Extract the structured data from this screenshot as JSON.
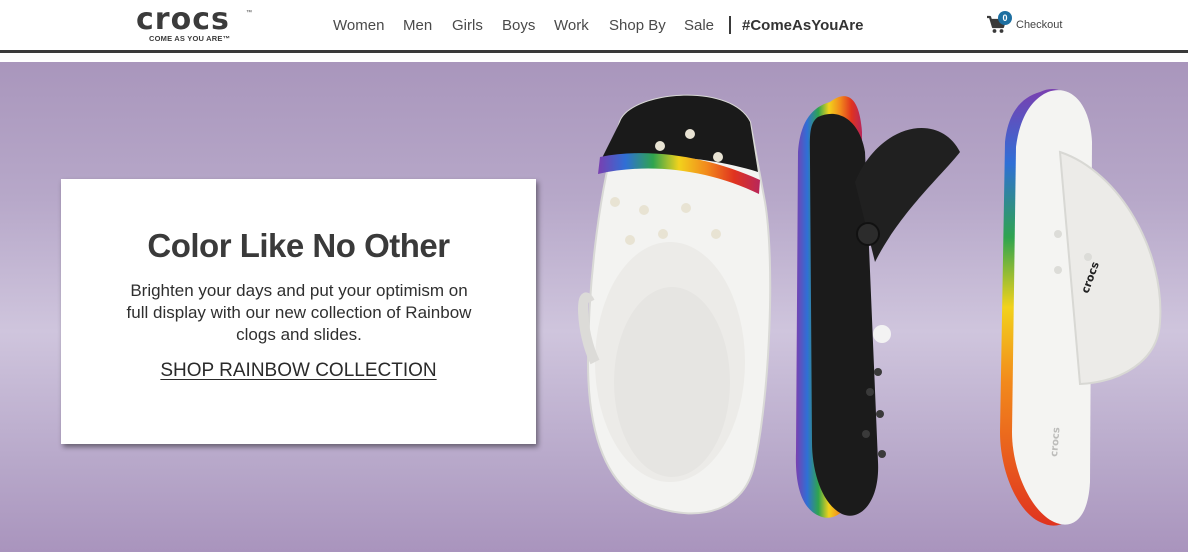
{
  "brand": {
    "name": "crocs",
    "trademark": "™",
    "tagline": "COME AS YOU ARE™"
  },
  "nav": {
    "items": [
      "Women",
      "Men",
      "Girls",
      "Boys",
      "Work",
      "Shop By",
      "Sale"
    ],
    "hashtag": "#ComeAsYouAre"
  },
  "cart": {
    "count": "0",
    "label": "Checkout",
    "icon": "shopping-cart-icon"
  },
  "hero": {
    "title": "Color Like No Other",
    "body": "Brighten your days and put your optimism on full display with our new collection of Rainbow clogs and slides.",
    "cta": "SHOP RAINBOW COLLECTION",
    "product_marks": [
      "crocs",
      "crocs"
    ]
  },
  "colors": {
    "hero_top": "#a996bc",
    "hero_mid": "#cfc5dd",
    "cart_badge": "#1d6fa1",
    "header_rule": "#3a3a3a"
  }
}
